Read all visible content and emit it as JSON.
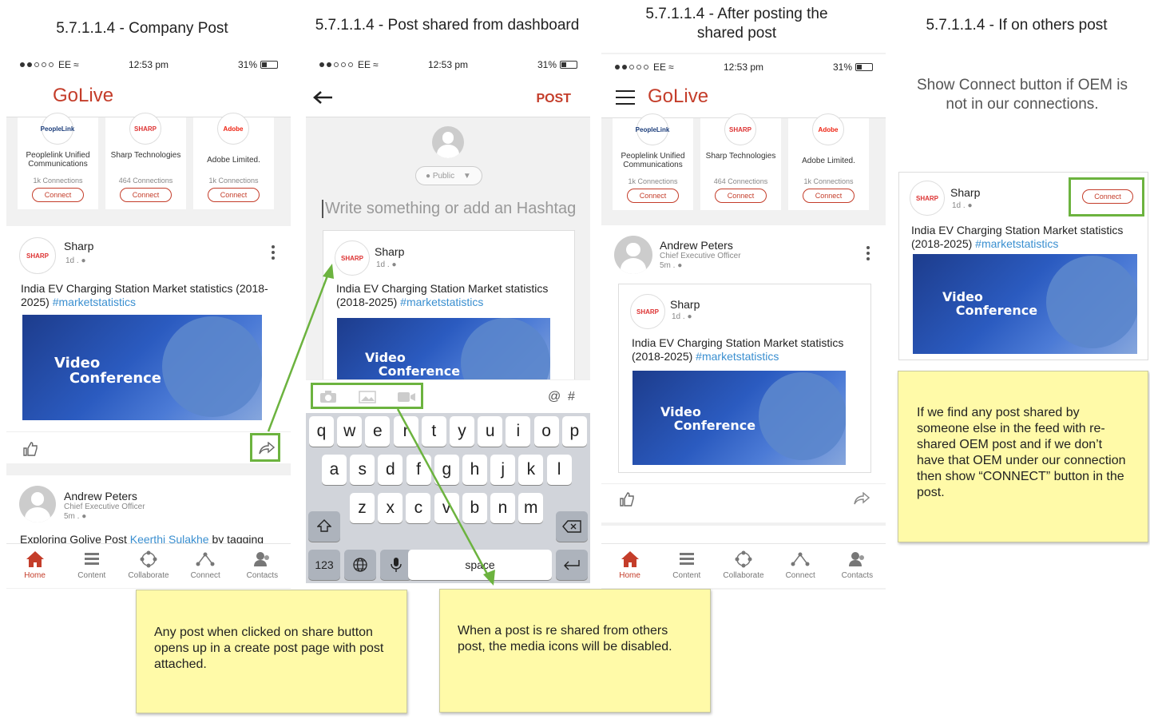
{
  "titles": [
    "5.7.1.1.4 - Company Post",
    "5.7.1.1.4 - Post shared from dashboard",
    "5.7.1.1.4 - After posting the shared post",
    "5.7.1.1.4 - If on others post"
  ],
  "status": {
    "carrier": "EE",
    "time": "12:53 pm",
    "battery": "31%"
  },
  "app": {
    "logo": "GoLive",
    "post_label": "POST"
  },
  "companies": [
    {
      "logo": "PeopleLink",
      "name": "Peoplelink Unified Communications",
      "connections": "1k Connections",
      "button": "Connect"
    },
    {
      "logo": "SHARP",
      "name": "Sharp Technologies",
      "connections": "464 Connections",
      "button": "Connect"
    },
    {
      "logo": "Adobe",
      "name": "Adobe Limited.",
      "connections": "1k Connections",
      "button": "Connect"
    }
  ],
  "company_post": {
    "author": "Sharp",
    "avatar": "SHARP",
    "meta": "1d .",
    "text": "India EV Charging Station Market statistics (2018-2025)",
    "hashtag": "#marketstatistics",
    "image_text_1": "Video",
    "image_text_2": "Conference"
  },
  "user_post": {
    "author": "Andrew Peters",
    "title": "Chief Executive Officer",
    "meta": "5m .",
    "text_prefix": "Exploring Golive Post ",
    "mention": "Keerthi Sulakhe",
    "text_suffix": " by tagging"
  },
  "compose": {
    "visibility": "Public",
    "placeholder": "Write something or add an Hashtag"
  },
  "keyboard": {
    "row1": [
      "q",
      "w",
      "e",
      "r",
      "t",
      "y",
      "u",
      "i",
      "o",
      "p"
    ],
    "row2": [
      "a",
      "s",
      "d",
      "f",
      "g",
      "h",
      "j",
      "k",
      "l"
    ],
    "row3": [
      "z",
      "x",
      "c",
      "v",
      "b",
      "n",
      "m"
    ],
    "num": "123",
    "space": "space",
    "at": "@",
    "hash": "#"
  },
  "nav": [
    "Home",
    "Content",
    "Collaborate",
    "Connect",
    "Contacts"
  ],
  "others": {
    "description": "Show Connect button if OEM is not in our connections.",
    "connect": "Connect"
  },
  "notes": [
    "Any post when clicked on share button opens up in a create post page with post attached.",
    "When a post is re shared from others post, the media icons will be disabled.",
    "If we find any post shared by someone else in the feed with re-shared OEM post and if we don’t have that OEM under our connection then show “CONNECT” button in the post."
  ],
  "colors": {
    "brand": "#c43d2a",
    "hashtag": "#3a8fd0",
    "highlight": "#6cb33f",
    "note": "#fffaa8"
  }
}
